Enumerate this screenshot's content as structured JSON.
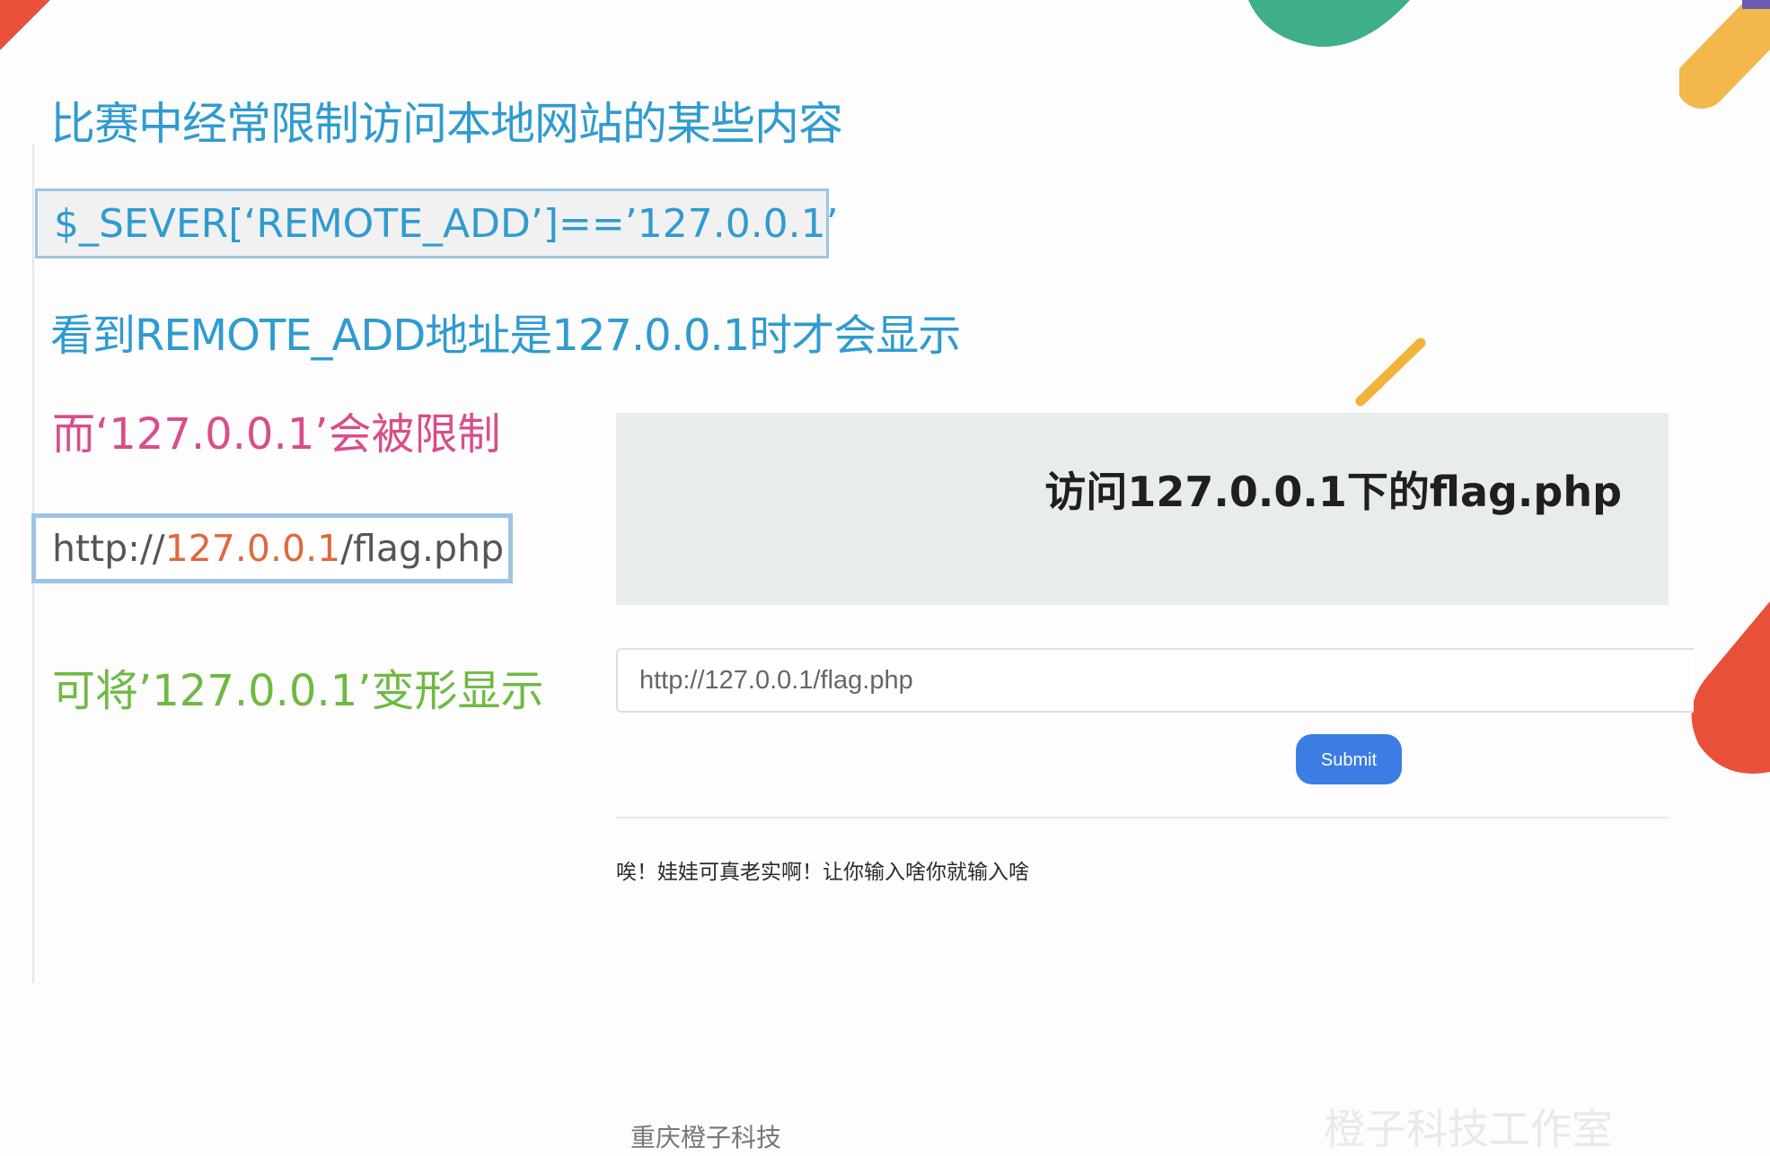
{
  "slide": {
    "title": "比赛中经常限制访问本地网站的某些内容",
    "code_line": "$_SEVER[‘REMOTE_ADD’]==’127.0.0.1’",
    "line2": "看到REMOTE_ADD地址是127.0.0.1时才会显示",
    "line3": "而‘127.0.0.1’会被限制",
    "url_prefix": "http://",
    "url_ip": "127.0.0.1",
    "url_suffix": "/flag.php",
    "line4": "可将’127.0.0.1’变形显示"
  },
  "panel": {
    "title": "访问127.0.0.1下的flag.php",
    "input_placeholder": "http://127.0.0.1/flag.php",
    "submit_label": "Submit",
    "response_text": "唉！娃娃可真老实啊！让你输入啥你就输入啥"
  },
  "footer": {
    "company": "重庆橙子科技",
    "watermark": "橙子科技工作室"
  },
  "colors": {
    "title_blue": "#2f9bd0",
    "pink": "#d94d8a",
    "green": "#6fb943",
    "ip_orange": "#e0683c",
    "button_blue": "#3b7de3"
  }
}
